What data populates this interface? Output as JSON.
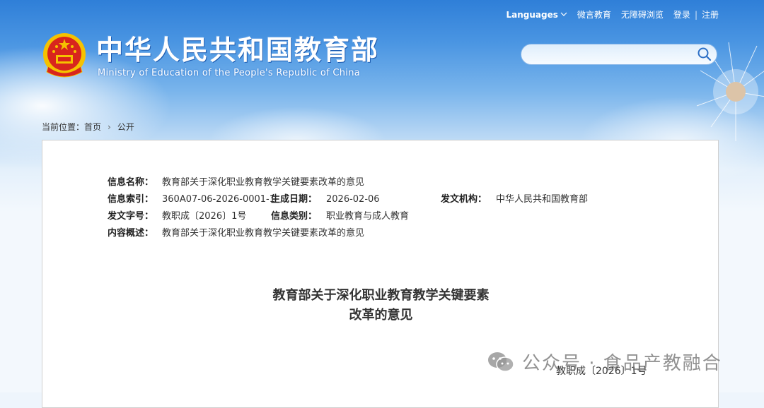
{
  "topnav": {
    "languages": "Languages",
    "wechat": "微言教育",
    "accessibility": "无障碍浏览",
    "login": "登录",
    "separator": "|",
    "register": "注册"
  },
  "header": {
    "title": "中华人民共和国教育部",
    "subtitle": "Ministry of Education of the People's Republic of China"
  },
  "search": {
    "placeholder": ""
  },
  "breadcrumb": {
    "label": "当前位置：",
    "items": [
      "首页",
      "公开"
    ],
    "separator": "›"
  },
  "meta": {
    "name_label": "信息名称：",
    "name_value": "教育部关于深化职业教育教学关键要素改革的意见",
    "index_label": "信息索引：",
    "index_value": "360A07-06-2026-0001-1",
    "date_label": "生成日期：",
    "date_value": "2026-02-06",
    "org_label": "发文机构：",
    "org_value": "中华人民共和国教育部",
    "docno_label": "发文字号：",
    "docno_value": "教职成〔2026〕1号",
    "category_label": "信息类别：",
    "category_value": "职业教育与成人教育",
    "summary_label": "内容概述：",
    "summary_value": "教育部关于深化职业教育教学关键要素改革的意见"
  },
  "document": {
    "title_line1": "教育部关于深化职业教育教学关键要素",
    "title_line2": "改革的意见",
    "number": "教职成〔2026〕1号"
  },
  "watermark": {
    "text": "公众号 · 食品产教融合"
  },
  "colors": {
    "sky_top": "#2f7fd8",
    "emblem_red": "#d8251d",
    "emblem_gold": "#f5c200"
  }
}
